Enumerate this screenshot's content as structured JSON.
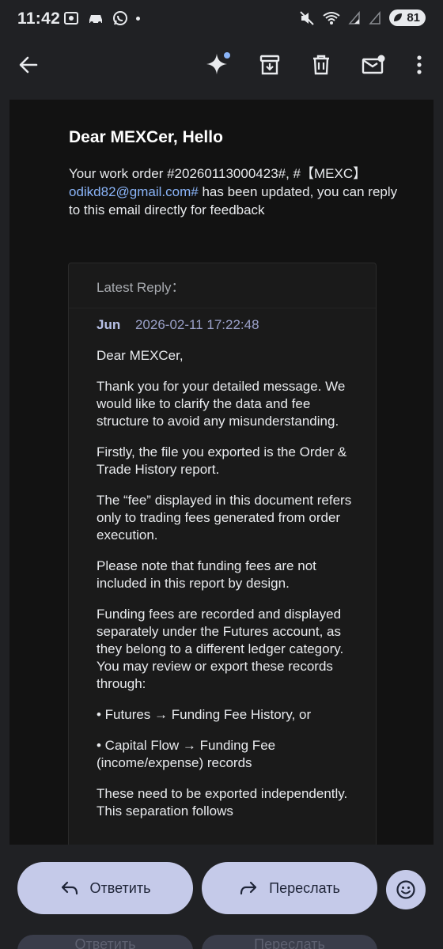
{
  "status_bar": {
    "time": "11:42",
    "battery": "81",
    "left_icons": [
      "screenshot-icon",
      "car-icon",
      "whatsapp-icon",
      "dot-icon"
    ],
    "right_icons": [
      "mute-icon",
      "wifi-icon",
      "signal-icon",
      "signal-icon-2"
    ]
  },
  "toolbar": {
    "icons": [
      "back-arrow-icon",
      "gemini-sparkle-icon",
      "archive-icon",
      "trash-icon",
      "mark-unread-icon",
      "more-vert-icon"
    ]
  },
  "email": {
    "greeting": "Dear MEXCer, Hello",
    "intro_part1": "Your work order #20260113000423#, #【MEXC】",
    "intro_link": "odikd82@gmail.com#",
    "intro_part2": " has been updated, you can reply to this email directly for feedback",
    "latest_reply_label": "Latest Reply：",
    "reply_author": "Jun",
    "reply_datetime": "2026-02-11 17:22:48",
    "paragraphs": [
      "Dear MEXCer,",
      "Thank you for your detailed message. We would like to clarify the data and fee structure to avoid any misunderstanding.",
      "Firstly, the file you exported is the Order & Trade History report.",
      "The “fee” displayed in this document refers only to trading fees generated from order execution.",
      "Please note that funding fees are not included in this report by design.",
      "Funding fees are recorded and displayed separately under the Futures account, as they belong to a different ledger category. You may review or export these records through:",
      "• Futures → Funding Fee History, or",
      "• Capital Flow → Funding Fee (income/expense) records",
      "These need to be exported independently. This separation follows"
    ]
  },
  "actions": {
    "reply_label": "Ответить",
    "forward_label": "Переслать"
  },
  "colors": {
    "background": "#202124",
    "content_bg": "#121212",
    "pill_bg": "#c5cae9",
    "link": "#8ab4f8"
  }
}
